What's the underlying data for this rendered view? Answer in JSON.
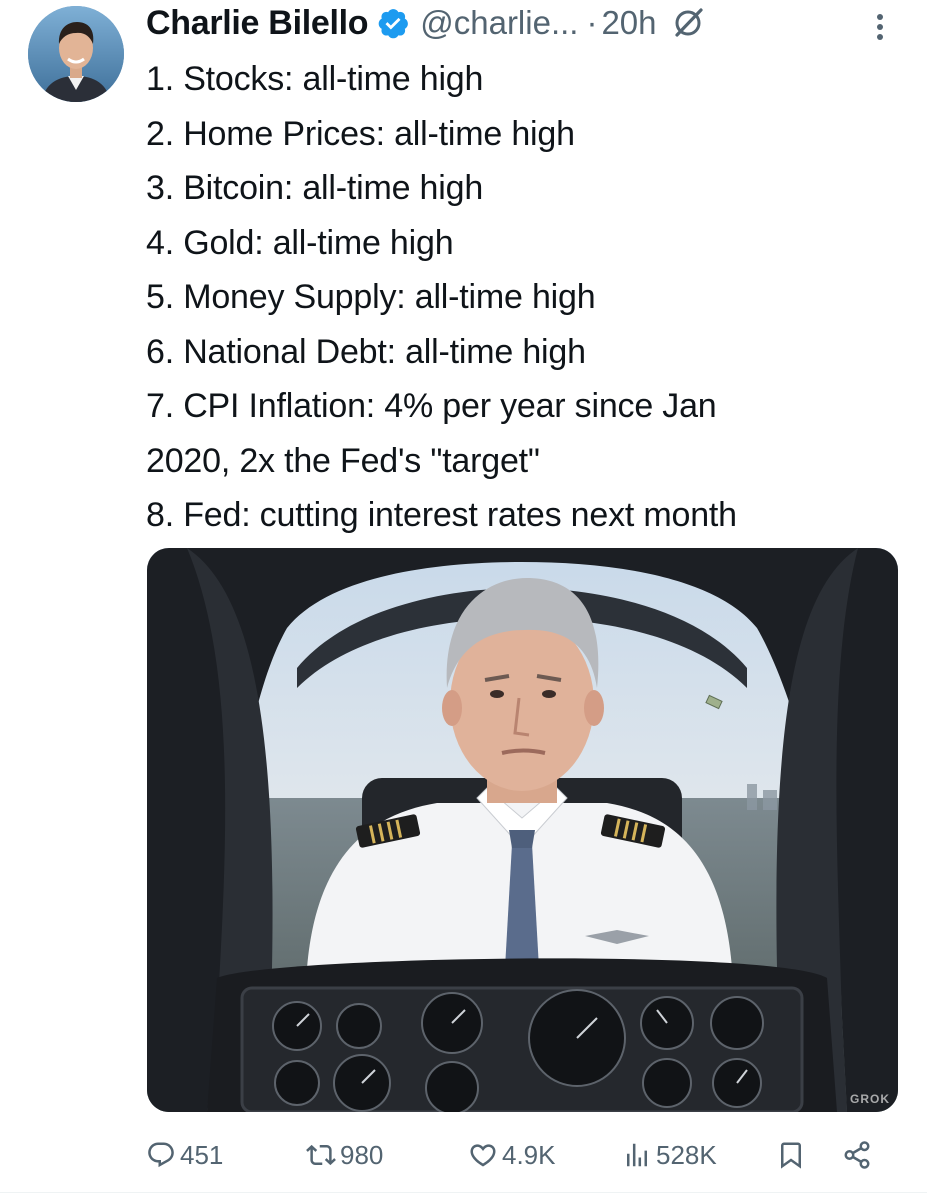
{
  "tweet": {
    "author_name": "Charlie Bilello",
    "handle": "@charlie...",
    "separator": "·",
    "time": "20h",
    "lines": [
      "1. Stocks: all-time high",
      "2. Home Prices: all-time high",
      "3. Bitcoin: all-time high",
      "4. Gold: all-time high",
      "5. Money Supply: all-time high",
      "6. National Debt: all-time high",
      "7. CPI Inflation: 4% per year since Jan",
      "2020, 2x the Fed's \"target\"",
      "8. Fed: cutting interest rates next month"
    ],
    "media_watermark": "GROK"
  },
  "actions": {
    "replies": "451",
    "reposts": "980",
    "likes": "4.9K",
    "views": "528K"
  },
  "icons": {
    "verified": "verified-badge-icon",
    "grok": "grok-icon",
    "more": "more-icon",
    "reply": "reply-icon",
    "repost": "repost-icon",
    "like": "heart-icon",
    "views": "views-icon",
    "bookmark": "bookmark-icon",
    "share": "share-icon"
  },
  "colors": {
    "text": "#0f1419",
    "secondary": "#536471",
    "verified_blue": "#1d9bf0"
  }
}
